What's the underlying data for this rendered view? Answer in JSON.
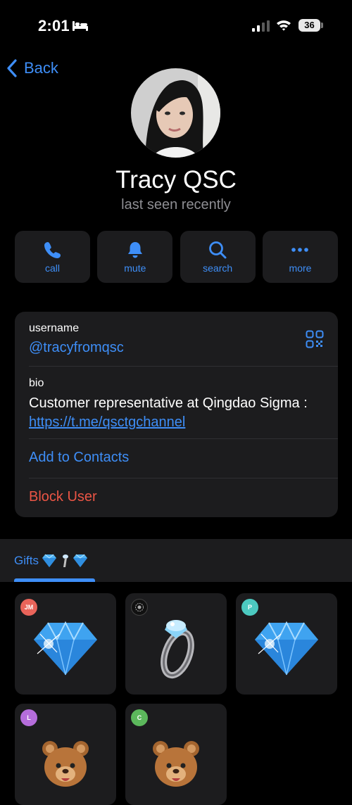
{
  "status_bar": {
    "time": "2:01",
    "battery": "36"
  },
  "nav": {
    "back_label": "Back"
  },
  "profile": {
    "name": "Tracy QSC",
    "status": "last seen recently"
  },
  "actions": [
    {
      "label": "call",
      "icon": "phone-icon"
    },
    {
      "label": "mute",
      "icon": "bell-icon"
    },
    {
      "label": "search",
      "icon": "search-icon"
    },
    {
      "label": "more",
      "icon": "more-icon"
    }
  ],
  "info": {
    "username_label": "username",
    "username_value": "@tracyfromqsc",
    "bio_label": "bio",
    "bio_text": "Customer representative at Qingdao Sigma : ",
    "bio_link": "https://t.me/qsctgchannel",
    "add_contact": "Add to Contacts",
    "block_user": "Block User"
  },
  "tabs": {
    "gifts_label": "Gifts"
  },
  "gifts": [
    {
      "badge": "JM",
      "badge_color": "#e9645a",
      "item": "diamond"
    },
    {
      "badge": "",
      "badge_color": "#111111",
      "item": "ring"
    },
    {
      "badge": "P",
      "badge_color": "#4cc9c0",
      "item": "diamond"
    },
    {
      "badge": "L",
      "badge_color": "#b56ddb",
      "item": "teddy-bear"
    },
    {
      "badge": "C",
      "badge_color": "#5cb85c",
      "item": "teddy-bear"
    }
  ],
  "colors": {
    "accent": "#3e8ef7",
    "destructive": "#eb5545",
    "card": "#1c1c1e"
  }
}
